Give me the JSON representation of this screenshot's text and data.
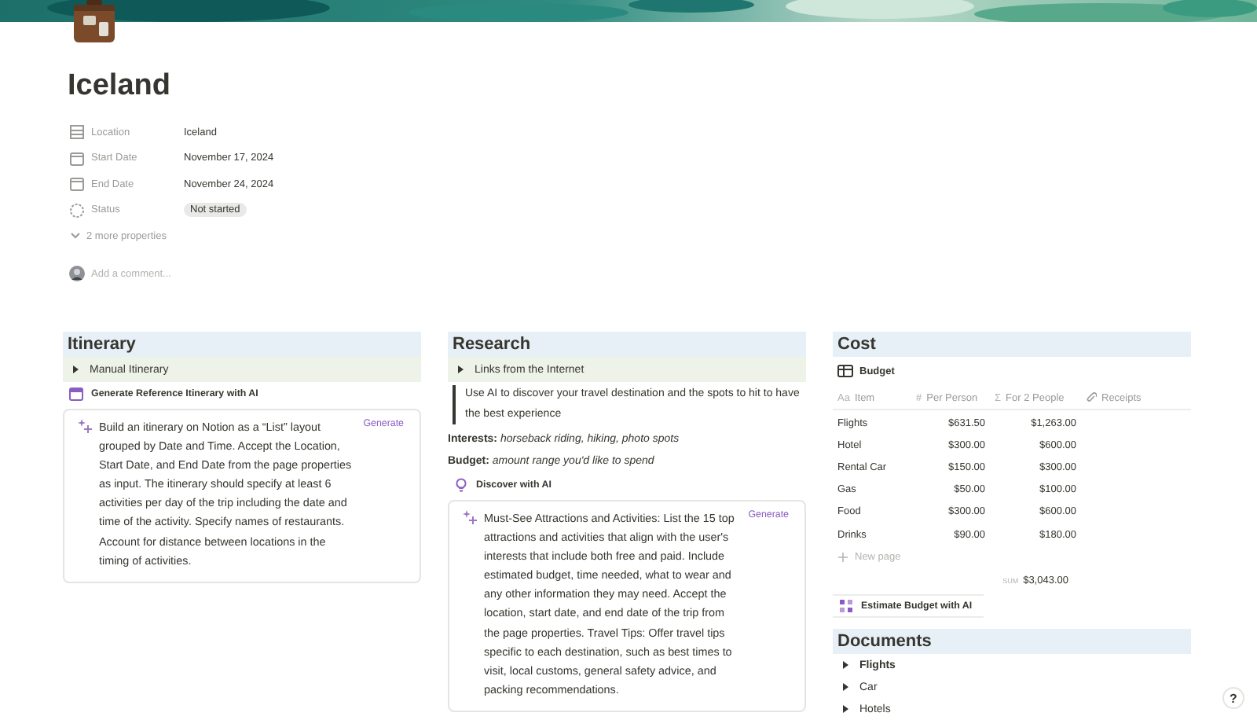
{
  "page": {
    "title": "Iceland"
  },
  "properties": [
    {
      "kind": "text",
      "label": "Location",
      "value": "Iceland"
    },
    {
      "kind": "date",
      "label": "Start Date",
      "value": "November 17, 2024"
    },
    {
      "kind": "date",
      "label": "End Date",
      "value": "November 24, 2024"
    },
    {
      "kind": "status",
      "label": "Status",
      "value": "Not started"
    }
  ],
  "more_properties": "2 more properties",
  "comment": {
    "placeholder": "Add a comment..."
  },
  "itinerary": {
    "heading": "Itinerary",
    "toggle": {
      "label": "Manual Itinerary",
      "expanded": false
    },
    "button": "Generate Reference Itinerary with AI",
    "ai_block": {
      "prompt": "Build an itinerary on Notion as a “List” layout grouped by Date and Time. Accept the Location, Start Date, and End Date from the page properties as input. The itinerary should specify at least 6 activities per day of the trip including the date and time of the activity. Specify names of restaurants. Account for distance between locations in the timing of activities.",
      "action": "Generate"
    }
  },
  "research": {
    "heading": "Research",
    "toggle": {
      "label": "Links from the Internet",
      "expanded": false
    },
    "quote": "Use AI to discover your travel destination and the spots to hit to have the best experience",
    "fields": [
      {
        "label": "Interests:",
        "value": "horseback riding, hiking, photo spots"
      },
      {
        "label": "Budget:",
        "value": "amount range you'd like to spend"
      }
    ],
    "button": "Discover with AI",
    "ai_block": {
      "prompt": "Must-See Attractions and Activities: List the 15 top attractions and activities that align with the user's interests that include both free and paid. Include estimated budget, time needed, what to wear and any other information they may need. Accept the location, start date, and end date of the trip from the page properties. Travel Tips: Offer travel tips specific to each destination, such as best times to visit, local customs, general safety advice, and packing recommendations.",
      "action": "Generate"
    }
  },
  "cost": {
    "heading": "Cost",
    "database": "Budget",
    "table": {
      "columns": [
        {
          "kind": "title",
          "label": "Item",
          "mark": "Aa"
        },
        {
          "kind": "number",
          "label": "Per Person",
          "mark": "#"
        },
        {
          "kind": "formula",
          "label": "For 2 People",
          "mark": "Σ"
        },
        {
          "kind": "files",
          "label": "Receipts"
        }
      ],
      "rows": [
        [
          "Flights",
          "$631.50",
          "$1,263.00"
        ],
        [
          "Hotel",
          "$300.00",
          "$600.00"
        ],
        [
          "Rental Car",
          "$150.00",
          "$300.00"
        ],
        [
          "Gas",
          "$50.00",
          "$100.00"
        ],
        [
          "Food",
          "$300.00",
          "$600.00"
        ],
        [
          "Drinks",
          "$90.00",
          "$180.00"
        ]
      ],
      "new_row": "New page",
      "sum_label": "SUM",
      "sum": "$3,043.00"
    },
    "button": "Estimate Budget with AI"
  },
  "documents": {
    "heading": "Documents",
    "items": [
      {
        "label": "Flights",
        "expanded": false
      },
      {
        "label": "Car",
        "expanded": false
      },
      {
        "label": "Hotels",
        "expanded": false
      }
    ]
  },
  "help_button": "?"
}
